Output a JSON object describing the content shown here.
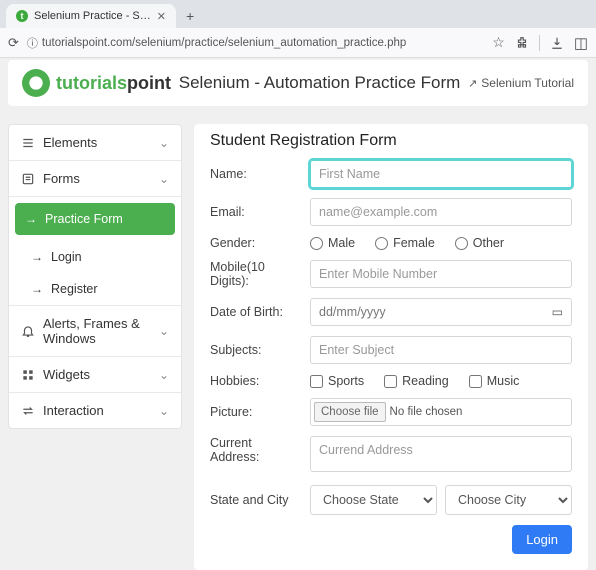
{
  "browser": {
    "tab_title": "Selenium Practice - Student",
    "url": "tutorialspoint.com/selenium/practice/selenium_automation_practice.php"
  },
  "header": {
    "brand_prefix": "tutorials",
    "brand_suffix": "point",
    "page_title": "Selenium - Automation Practice Form",
    "tutorial_link": "Selenium Tutorial"
  },
  "sidebar": {
    "elements": "Elements",
    "forms": "Forms",
    "forms_children": {
      "practice": "Practice Form",
      "login": "Login",
      "register": "Register"
    },
    "alerts": "Alerts, Frames & Windows",
    "widgets": "Widgets",
    "interaction": "Interaction"
  },
  "form": {
    "heading": "Student Registration Form",
    "name_label": "Name:",
    "name_placeholder": "First Name",
    "email_label": "Email:",
    "email_placeholder": "name@example.com",
    "gender_label": "Gender:",
    "gender_options": {
      "male": "Male",
      "female": "Female",
      "other": "Other"
    },
    "mobile_label": "Mobile(10 Digits):",
    "mobile_placeholder": "Enter Mobile Number",
    "dob_label": "Date of Birth:",
    "dob_placeholder": "dd/mm/yyyy",
    "subjects_label": "Subjects:",
    "subjects_placeholder": "Enter Subject",
    "hobbies_label": "Hobbies:",
    "hobbies_options": {
      "sports": "Sports",
      "reading": "Reading",
      "music": "Music"
    },
    "picture_label": "Picture:",
    "file_button": "Choose file",
    "file_status": "No file chosen",
    "address_label": "Current Address:",
    "address_placeholder": "Currend Address",
    "state_city_label": "State and City",
    "state_placeholder": "Choose State",
    "city_placeholder": "Choose City",
    "submit_label": "Login"
  }
}
